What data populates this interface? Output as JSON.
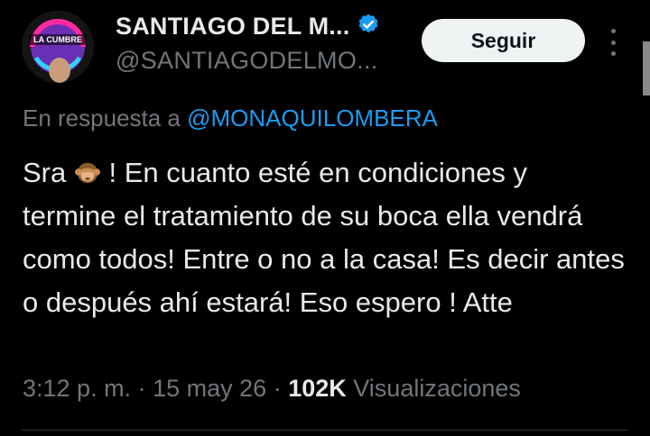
{
  "profile": {
    "avatar_text": "LA CUMBRE",
    "name": "SANTIAGO DEL M...",
    "handle": "@SANTIAGODELMO...",
    "verified": true
  },
  "actions": {
    "follow_label": "Seguir",
    "more_icon": "more-vertical-icon"
  },
  "reply": {
    "prefix": "En respuesta a",
    "mention": "@MONAQUILOMBERA"
  },
  "tweet": {
    "before_emoji": "Sra ",
    "emoji": "see-no-evil-monkey",
    "after_emoji": " ! En cuanto esté en condiciones y termine el tratamiento de su boca ella vendrá como todos! Entre o no a la casa! Es decir antes o después ahí estará! Eso espero ! Atte"
  },
  "meta": {
    "time": "3:12 p. m.",
    "separator": "·",
    "date": "15 may 26",
    "views_count": "102K",
    "views_label": "Visualizaciones"
  },
  "colors": {
    "background": "#000000",
    "text": "#e7e9ea",
    "muted": "#71767b",
    "link": "#1d9bf0",
    "button_bg": "#eff3f4"
  }
}
